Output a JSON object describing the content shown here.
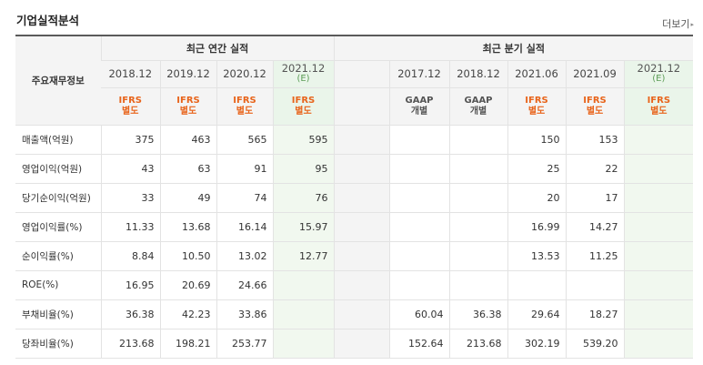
{
  "title": "기업실적분석",
  "more": {
    "label": "더보기",
    "arrow": "▸"
  },
  "header": {
    "row_label": "주요재무정보",
    "annual_title": "최근 연간 실적",
    "quarterly_title": "최근 분기 실적"
  },
  "columns": {
    "annual": [
      {
        "year": "2018.12",
        "sub": "",
        "acc1": "IFRS",
        "acc2": "별도"
      },
      {
        "year": "2019.12",
        "sub": "",
        "acc1": "IFRS",
        "acc2": "별도"
      },
      {
        "year": "2020.12",
        "sub": "",
        "acc1": "IFRS",
        "acc2": "별도"
      },
      {
        "year": "2021.12",
        "sub": "(E)",
        "acc1": "IFRS",
        "acc2": "별도"
      }
    ],
    "quarterly": [
      {
        "year": "",
        "sub": "",
        "acc1": "",
        "acc2": ""
      },
      {
        "year": "2017.12",
        "sub": "",
        "acc1": "GAAP",
        "acc2": "개별"
      },
      {
        "year": "2018.12",
        "sub": "",
        "acc1": "GAAP",
        "acc2": "개별"
      },
      {
        "year": "2021.06",
        "sub": "",
        "acc1": "IFRS",
        "acc2": "별도"
      },
      {
        "year": "2021.09",
        "sub": "",
        "acc1": "IFRS",
        "acc2": "별도"
      },
      {
        "year": "2021.12",
        "sub": "(E)",
        "acc1": "IFRS",
        "acc2": "별도"
      }
    ]
  },
  "rows": [
    {
      "label": "매출액(억원)",
      "annual": [
        "375",
        "463",
        "565",
        "595"
      ],
      "quarterly": [
        "",
        "",
        "",
        "150",
        "153",
        ""
      ]
    },
    {
      "label": "영업이익(억원)",
      "annual": [
        "43",
        "63",
        "91",
        "95"
      ],
      "quarterly": [
        "",
        "",
        "",
        "25",
        "22",
        ""
      ]
    },
    {
      "label": "당기순이익(억원)",
      "annual": [
        "33",
        "49",
        "74",
        "76"
      ],
      "quarterly": [
        "",
        "",
        "",
        "20",
        "17",
        ""
      ]
    },
    {
      "label": "영업이익률(%)",
      "annual": [
        "11.33",
        "13.68",
        "16.14",
        "15.97"
      ],
      "quarterly": [
        "",
        "",
        "",
        "16.99",
        "14.27",
        ""
      ]
    },
    {
      "label": "순이익률(%)",
      "annual": [
        "8.84",
        "10.50",
        "13.02",
        "12.77"
      ],
      "quarterly": [
        "",
        "",
        "",
        "13.53",
        "11.25",
        ""
      ]
    },
    {
      "label": "ROE(%)",
      "annual": [
        "16.95",
        "20.69",
        "24.66",
        ""
      ],
      "quarterly": [
        "",
        "",
        "",
        "",
        "",
        ""
      ]
    },
    {
      "label": "부채비율(%)",
      "annual": [
        "36.38",
        "42.23",
        "33.86",
        ""
      ],
      "quarterly": [
        "",
        "60.04",
        "36.38",
        "29.64",
        "18.27",
        ""
      ]
    },
    {
      "label": "당좌비율(%)",
      "annual": [
        "213.68",
        "198.21",
        "253.77",
        ""
      ],
      "quarterly": [
        "",
        "152.64",
        "213.68",
        "302.19",
        "539.20",
        ""
      ]
    }
  ]
}
